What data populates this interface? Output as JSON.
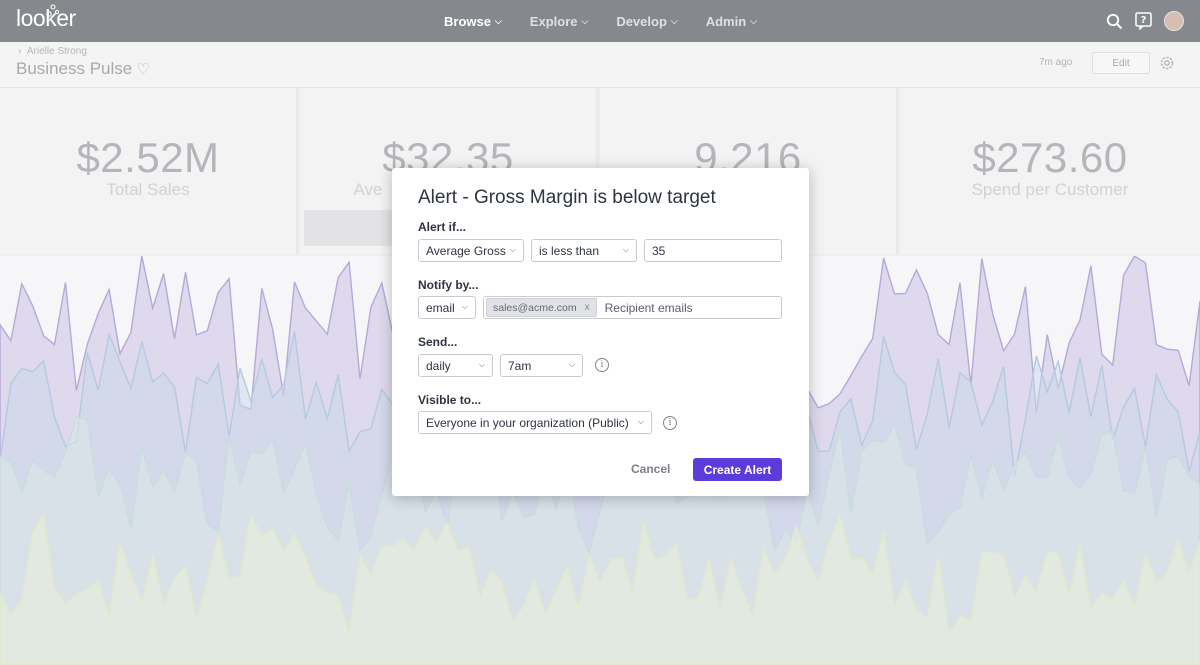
{
  "nav": {
    "logo": "looker",
    "menu": [
      {
        "label": "Browse",
        "active": true
      },
      {
        "label": "Explore",
        "active": false
      },
      {
        "label": "Develop",
        "active": false
      },
      {
        "label": "Admin",
        "active": false
      }
    ],
    "icons": [
      "search-icon",
      "help-icon",
      "avatar"
    ]
  },
  "dashboard": {
    "breadcrumb": "Arielle Strong",
    "title": "Business Pulse",
    "updated": "7m ago",
    "edit_label": "Edit"
  },
  "tiles": [
    {
      "value": "$2.52M",
      "label": "Total Sales"
    },
    {
      "value": "$32.35",
      "label": "Ave"
    },
    {
      "value": "9,216",
      "label": ""
    },
    {
      "value": "$273.60",
      "label": "Spend per Customer"
    }
  ],
  "modal": {
    "title": "Alert - Gross Margin is below target",
    "alert_if_label": "Alert if...",
    "field_value": "Average Gross",
    "condition_value": "is less than",
    "threshold_value": "35",
    "notify_label": "Notify by...",
    "notify_method": "email",
    "recipient_chip": "sales@acme.com",
    "recipient_placeholder": "Recipient emails",
    "send_label": "Send...",
    "frequency": "daily",
    "time": "7am",
    "visible_label": "Visible to...",
    "visibility": "Everyone in your organization (Public)",
    "cancel_label": "Cancel",
    "create_label": "Create Alert"
  },
  "colors": {
    "nav_bg": "#5d6066",
    "primary_button": "#5b3bd9",
    "chart_series": [
      "#b8abd9",
      "#b9cde3",
      "#cfe0df",
      "#e5ebcf"
    ]
  }
}
